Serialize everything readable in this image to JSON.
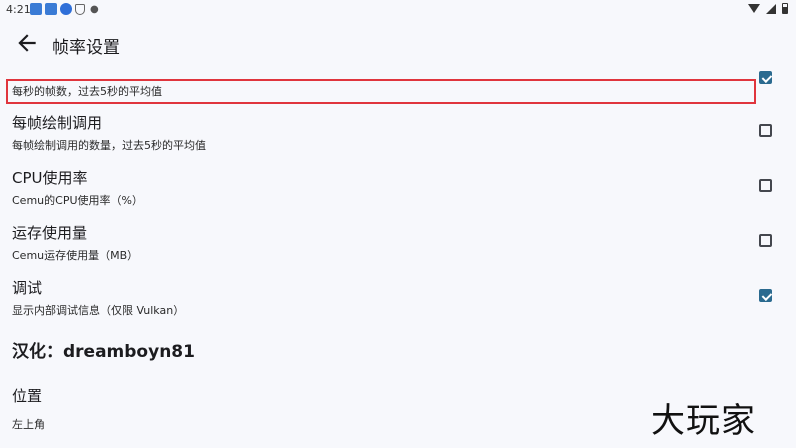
{
  "status_bar": {
    "time": "4:21",
    "notification_icons": [
      "app-icon",
      "app-icon",
      "download-icon",
      "shield-icon"
    ],
    "system_icons": [
      "wifi-icon",
      "signal-icon",
      "battery-icon"
    ]
  },
  "header": {
    "title": "帧率设置"
  },
  "settings": [
    {
      "title": "",
      "summary": "每秒的帧数，过去5秒的平均值",
      "checked": true
    },
    {
      "title": "每帧绘制调用",
      "summary": "每帧绘制调用的数量，过去5秒的平均值",
      "checked": false
    },
    {
      "title": "CPU使用率",
      "summary": "Cemu的CPU使用率（%）",
      "checked": false
    },
    {
      "title": "运存使用量",
      "summary": "Cemu运存使用量（MB）",
      "checked": false
    },
    {
      "title": "调试",
      "summary": "显示内部调试信息（仅限 Vulkan）",
      "checked": true
    }
  ],
  "section": {
    "title": "汉化：dreamboyn81"
  },
  "position_setting": {
    "title": "位置",
    "value": "左上角"
  },
  "watermark": "大玩家",
  "colors": {
    "highlight": "#e0353d",
    "checkbox_checked": "#2a6a8f",
    "background": "#f7f8fc"
  }
}
